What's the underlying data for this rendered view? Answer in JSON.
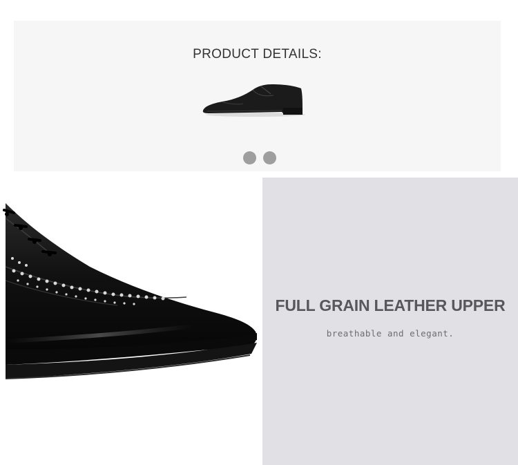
{
  "banner": {
    "title": "PRODUCT DETAILS:",
    "image": "oxford-shoe-side-view",
    "carousel_dots": [
      {
        "label": "slide-1"
      },
      {
        "label": "slide-2"
      }
    ]
  },
  "detail_image": {
    "image": "brogue-shoe-closeup"
  },
  "feature": {
    "title": "FULL GRAIN LEATHER UPPER",
    "subtitle": "breathable and elegant."
  },
  "colors": {
    "banner_bg": "#f6f6f6",
    "feature_bg": "#e1e0e5",
    "title_text": "#58575c",
    "dot": "#9e9e9e"
  }
}
